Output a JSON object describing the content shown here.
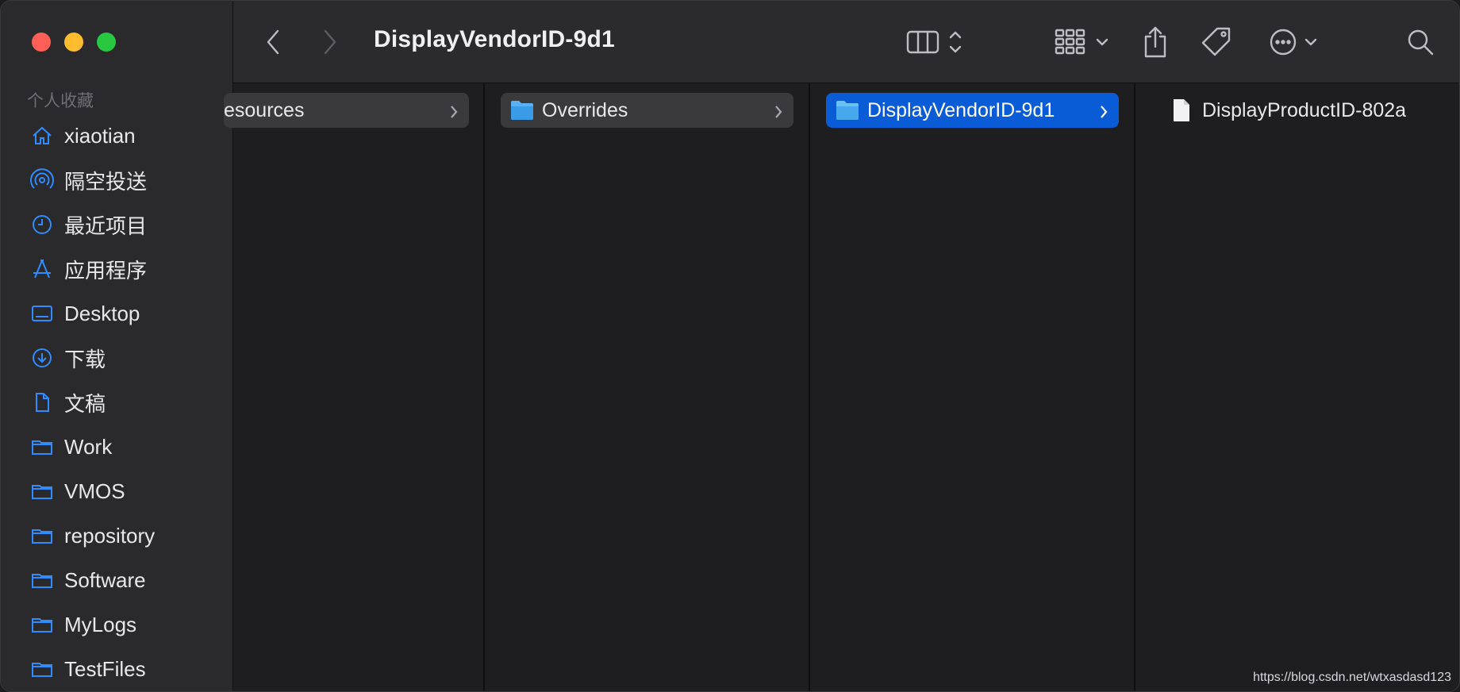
{
  "window": {
    "title": "DisplayVendorID-9d1"
  },
  "sidebar": {
    "section_title": "个人收藏",
    "items": [
      {
        "label": "xiaotian",
        "icon": "home-icon"
      },
      {
        "label": "隔空投送",
        "icon": "airdrop-icon"
      },
      {
        "label": "最近项目",
        "icon": "clock-icon"
      },
      {
        "label": "应用程序",
        "icon": "applications-icon"
      },
      {
        "label": "Desktop",
        "icon": "desktop-icon"
      },
      {
        "label": "下载",
        "icon": "download-icon"
      },
      {
        "label": "文稿",
        "icon": "document-icon"
      },
      {
        "label": "Work",
        "icon": "folder-icon"
      },
      {
        "label": "VMOS",
        "icon": "folder-icon"
      },
      {
        "label": "repository",
        "icon": "folder-icon"
      },
      {
        "label": "Software",
        "icon": "folder-icon"
      },
      {
        "label": "MyLogs",
        "icon": "folder-icon"
      },
      {
        "label": "TestFiles",
        "icon": "folder-icon"
      }
    ]
  },
  "columns": [
    {
      "label": "esources",
      "type": "folder",
      "state": "path"
    },
    {
      "label": "Overrides",
      "type": "folder",
      "state": "path"
    },
    {
      "label": "DisplayVendorID-9d1",
      "type": "folder",
      "state": "selected"
    },
    {
      "label": "DisplayProductID-802a",
      "type": "file",
      "state": "normal"
    }
  ],
  "watermark": "https://blog.csdn.net/wtxasdasd123",
  "colors": {
    "accent": "#2f8cff",
    "selection": "#0a5bd6",
    "sidebar_bg": "#2a2a2c",
    "toolbar_bg": "#2b2b2d"
  }
}
